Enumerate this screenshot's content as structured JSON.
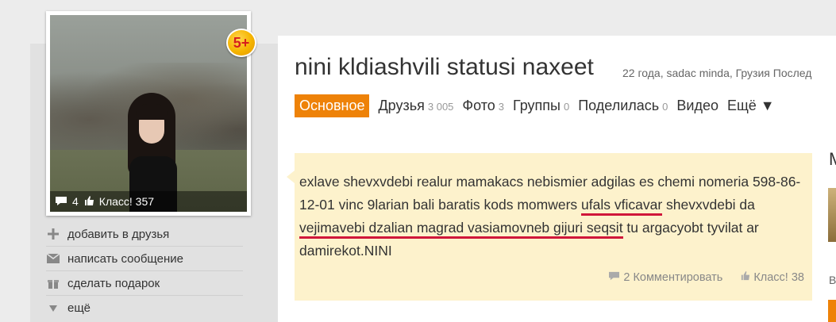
{
  "profile": {
    "name": "nini kldiashvili statusi naxeet",
    "subinfo": "22 года, sadac minda, Грузия Послед",
    "badge": "5+",
    "photo_stats": {
      "comments": "4",
      "likes_label": "Класс! 357"
    }
  },
  "actions": [
    {
      "icon": "plus-icon",
      "label": "добавить в друзья"
    },
    {
      "icon": "envelope-icon",
      "label": "написать сообщение"
    },
    {
      "icon": "gift-icon",
      "label": "сделать подарок"
    },
    {
      "icon": "triangle-down-icon",
      "label": "ещё"
    }
  ],
  "tabs": [
    {
      "label": "Основное",
      "count": "",
      "active": true
    },
    {
      "label": "Друзья",
      "count": "3 005"
    },
    {
      "label": "Фото",
      "count": "3"
    },
    {
      "label": "Группы",
      "count": "0"
    },
    {
      "label": "Поделилась",
      "count": "0"
    },
    {
      "label": "Видео",
      "count": ""
    },
    {
      "label": "Ещё ▼",
      "count": ""
    }
  ],
  "status": {
    "part1": "exlave shevxvdebi realur mamakacs nebismier adgilas es chemi nomeria 598-86-12-01 vinc 9larian bali baratis kods momwers ",
    "underlined1": "ufals vficavar",
    "part2": " shevxvdebi da ",
    "underlined2": "vejimavebi dzalian magrad vasiamovneb gijuri seqsit",
    "part3": " tu argacyobt tyvilat ar damirekot.NINI",
    "comments_label": "2 Комментировать",
    "likes_label": "Класс! 38"
  },
  "right_panel": {
    "letter": "M",
    "small_text": "B"
  },
  "colors": {
    "accent": "#ee8208",
    "underline": "#d0173a",
    "card_bg": "#fdf2cc"
  }
}
